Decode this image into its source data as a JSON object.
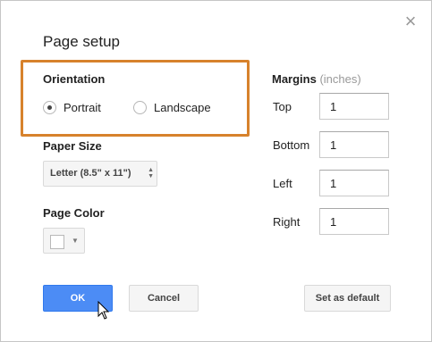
{
  "dialog": {
    "title": "Page setup",
    "close_glyph": "×"
  },
  "orientation": {
    "label": "Orientation",
    "options": [
      {
        "label": "Portrait",
        "checked": true
      },
      {
        "label": "Landscape",
        "checked": false
      }
    ]
  },
  "paper_size": {
    "label": "Paper Size",
    "selected": "Letter (8.5\" x 11\")"
  },
  "page_color": {
    "label": "Page Color",
    "value": "#ffffff"
  },
  "margins": {
    "label": "Margins",
    "unit": "(inches)",
    "fields": [
      {
        "label": "Top",
        "value": "1"
      },
      {
        "label": "Bottom",
        "value": "1"
      },
      {
        "label": "Left",
        "value": "1"
      },
      {
        "label": "Right",
        "value": "1"
      }
    ]
  },
  "buttons": {
    "ok": "OK",
    "cancel": "Cancel",
    "set_default": "Set as default"
  },
  "colors": {
    "accent": "#4c8cf5",
    "highlight_border": "#d7822c"
  }
}
